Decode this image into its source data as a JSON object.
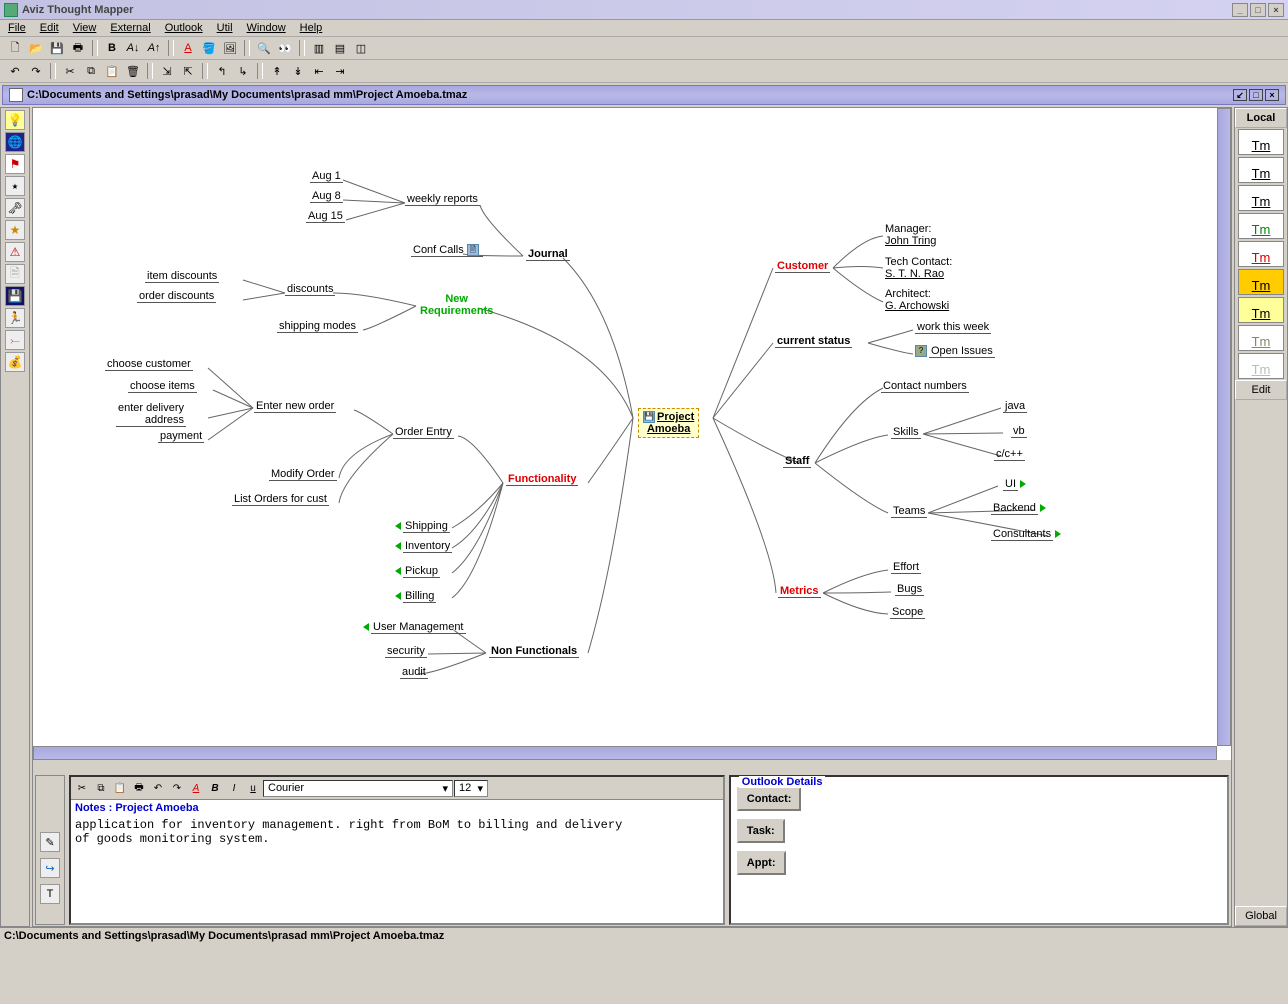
{
  "app": {
    "title": "Aviz Thought Mapper"
  },
  "menu": [
    "File",
    "Edit",
    "View",
    "External",
    "Outlook",
    "Util",
    "Window",
    "Help"
  ],
  "docpath": "C:\\Documents and Settings\\prasad\\My Documents\\prasad mm\\Project Amoeba.tmaz",
  "status": "C:\\Documents and Settings\\prasad\\My Documents\\prasad mm\\Project Amoeba.tmaz",
  "right": {
    "top": "Local",
    "edit": "Edit",
    "bottom": "Global"
  },
  "center": {
    "line1": "Project",
    "line2": "Amoeba"
  },
  "branches": {
    "journal": {
      "label": "Journal",
      "weekly": "weekly reports",
      "aug1": "Aug 1",
      "aug8": "Aug 8",
      "aug15": "Aug 15",
      "conf": "Conf Calls"
    },
    "newreq": {
      "label1": "New",
      "label2": "Requirements",
      "discounts": "discounts",
      "item": "item discounts",
      "order": "order discounts",
      "shipping": "shipping modes"
    },
    "func": {
      "label": "Functionality",
      "orderentry": "Order Entry",
      "enternew": "Enter new order",
      "choosecust": "choose customer",
      "chooseitems": "choose items",
      "addr1": "enter delivery",
      "addr2": "address",
      "payment": "payment",
      "modify": "Modify Order",
      "list": "List Orders for cust",
      "ship": "Shipping",
      "inv": "Inventory",
      "pick": "Pickup",
      "bill": "Billing"
    },
    "nonfunc": {
      "label": "Non Functionals",
      "um": "User Management",
      "sec": "security",
      "aud": "audit"
    },
    "customer": {
      "label": "Customer",
      "mgr1": "Manager:",
      "mgr2": "John Tring",
      "tc1": "Tech Contact:",
      "tc2": "S. T. N. Rao",
      "ar1": "Architect:",
      "ar2": "G. Archowski"
    },
    "curstat": {
      "label": "current status",
      "work": "work this week",
      "open": "Open Issues"
    },
    "staff": {
      "label": "Staff",
      "contacts": "Contact numbers",
      "skills": "Skills",
      "java": "java",
      "vb": "vb",
      "cc": "c/c++",
      "teams": "Teams",
      "ui": "UI",
      "backend": "Backend",
      "cons": "Consultants"
    },
    "metrics": {
      "label": "Metrics",
      "effort": "Effort",
      "bugs": "Bugs",
      "scope": "Scope"
    }
  },
  "notes": {
    "font": "Courier",
    "size": "12",
    "title": "Notes : Project Amoeba",
    "body": "application for inventory management. right from BoM to billing and delivery\nof goods monitoring system."
  },
  "outlook": {
    "title": "Outlook Details",
    "contact": "Contact:",
    "task": "Task:",
    "appt": "Appt:"
  }
}
